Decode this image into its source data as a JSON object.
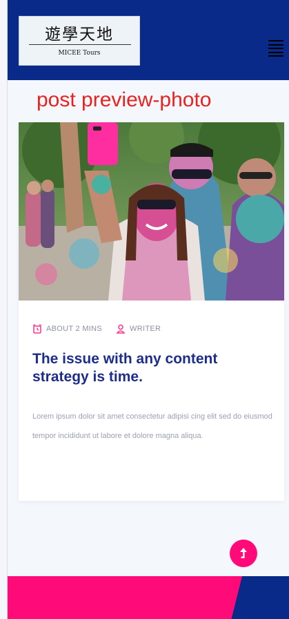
{
  "header": {
    "logo_title": "遊學天地",
    "logo_subtitle": "MICEE Tours",
    "menu_icon": "hamburger-menu-icon",
    "background_color": "#0a2a8a"
  },
  "annotation": "post preview-photo",
  "post": {
    "photo_description_icon": "festival-photo",
    "read_time": "ABOUT 2 MINS",
    "read_time_icon": "alarm-clock-icon",
    "author": "WRITER",
    "author_icon": "user-icon",
    "title": "The issue with any content strategy is time.",
    "excerpt": "Lorem ipsum dolor sit amet consectetur adipisi cing elit sed do eiusmod tempor incididunt ut labore et dolore magna aliqua."
  },
  "back_to_top": {
    "icon": "arrow-up-icon",
    "color": "#ff0a78"
  },
  "footer": {
    "primary_color": "#ff0a78",
    "secondary_color": "#0a2a8a"
  }
}
